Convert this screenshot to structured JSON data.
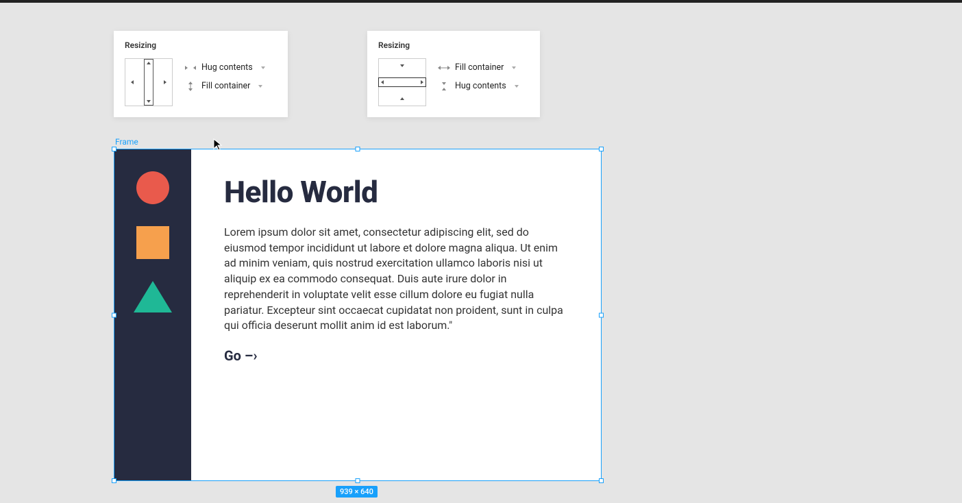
{
  "panel1": {
    "title": "Resizing",
    "options": [
      {
        "label": "Hug contents",
        "icon": "hug-h"
      },
      {
        "label": "Fill container",
        "icon": "fill-v"
      }
    ]
  },
  "panel2": {
    "title": "Resizing",
    "options": [
      {
        "label": "Fill container",
        "icon": "fill-h"
      },
      {
        "label": "Hug contents",
        "icon": "hug-v"
      }
    ]
  },
  "canvas": {
    "frame_label": "Frame",
    "heading": "Hello World",
    "body": "Lorem ipsum dolor sit amet, consectetur adipiscing elit, sed do eiusmod tempor incididunt ut labore et dolore magna aliqua. Ut enim ad minim veniam, quis nostrud exercitation ullamco laboris nisi ut aliquip ex ea commodo consequat. Duis aute irure dolor in reprehenderit in voluptate velit esse cillum dolore eu fugiat nulla pariatur. Excepteur sint occaecat cupidatat non proident, sunt in culpa qui officia deserunt mollit anim id est laborum.\"",
    "link": "Go –›",
    "dimensions": "939 × 640"
  }
}
